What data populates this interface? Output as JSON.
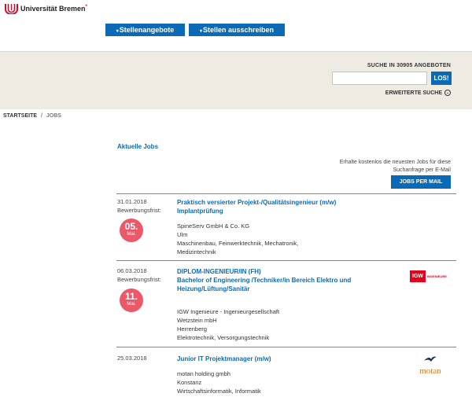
{
  "header": {
    "logo_text": "Universität Bremen",
    "logo_star": "*",
    "nav": [
      {
        "label": "Stellenangebote"
      },
      {
        "label": "Stellen ausschreiben"
      }
    ],
    "nav_bullet": "▾"
  },
  "search": {
    "label": "SUCHE IN 30905 ANGEBOTEN",
    "input_value": "",
    "button_label": "LOS!",
    "advanced_label": "ERWEITERTE SUCHE"
  },
  "breadcrumb": {
    "home": "STARTSEITE",
    "separator": "/",
    "current": "JOBS"
  },
  "main": {
    "section_title": "Aktuelle Jobs",
    "promo_text": "Erhalte kostenlos die neuesten Jobs für diese Suchanfrage per E-Mail",
    "promo_button": "JOBS PER MAIL"
  },
  "jobs": [
    {
      "date": "31.01.2018",
      "deadline_label": "Bewerbungsfrist:",
      "deadline_day": "05.",
      "deadline_month": "Mai.",
      "title": "Praktisch versierter Projekt-/Qualitätsingenieur (m/w) Implantprüfung",
      "company": "SpineServ GmbH & Co. KG",
      "location": "Ulm",
      "fields_line1": "Maschinenbau, Feinwerktechnik, Mechatronik,",
      "fields_line2": "Medizintechnik"
    },
    {
      "date": "06.03.2018",
      "deadline_label": "Bewerbungsfrist:",
      "deadline_day": "11.",
      "deadline_month": "Mai.",
      "title_line1": "DIPLOM-INGENIEUR/IN (FH)",
      "title_line2": "Bachelor of Engineering /Techniker/in Bereich Elektro und Heizung/Lüftung/Sanitär",
      "company": "IGW Ingenieure - Ingenieurgesellschaft",
      "company_line2": "Wetzstein mbH",
      "location": "Herrenberg",
      "fields_line1": "Elektrotechnik, Versorgungstechnik",
      "logo_mark": "IGW",
      "logo_word": "INGENIEURE",
      "logo_color": "#e2001a"
    },
    {
      "date": "25.03.2018",
      "title": "Junior IT Projektmanager (m/w)",
      "company": "motan holding gmbh",
      "location": "Konstanz",
      "fields_line1": "Wirtschaftsinformatik, Informatik",
      "logo_word": "motan",
      "logo_color": "#e07b24"
    }
  ],
  "colors": {
    "accent": "#0a6ab5",
    "deadline": "#ec5868",
    "band": "#eeebe3",
    "brand_red": "#c8102e"
  }
}
